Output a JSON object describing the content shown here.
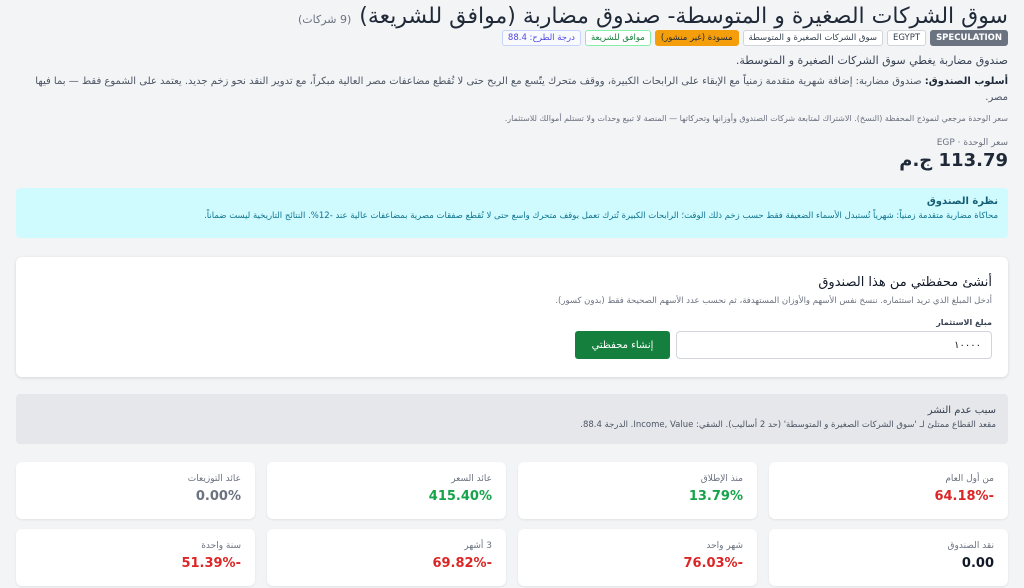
{
  "header": {
    "title": "سوق الشركات الصغيرة و المتوسطة- صندوق مضاربة (موافق للشريعة)",
    "count": "(9 شركات)"
  },
  "badges": [
    "SPECULATION",
    "EGYPT",
    "سوق الشركات الصغيرة و المتوسطة",
    "مسودة (غير منشور)",
    "موافق للشريعة",
    "درجة الطرح: 88.4"
  ],
  "subtitle": "صندوق مضاربة يغطي سوق الشركات الصغيرة و المتوسطة.",
  "style": {
    "label": "أسلوب الصندوق:",
    "text": " صندوق مضاربة: إضافة شهرية متقدمة زمنياً مع الإبقاء على الرابحات الكبيرة، ووقف متحرك يتّسع مع الربح حتى لا تُقطع مضاعفات مصر العالية مبكراً، مع تدوير النقد نحو زخم جديد. يعتمد على الشموع فقط — بما فيها مصر."
  },
  "disclaimer": "سعر الوحدة مرجعي لنموذج المحفظة (النسخ). الاشتراك لمتابعة شركات الصندوق وأوزانها وتحركاتها — المنصة لا تبيع وحدات ولا تستلم أموالك للاستثمار.",
  "unit_price": {
    "label": "سعر الوحدة · EGP",
    "value": "113.79 ج.م"
  },
  "view": {
    "title": "نظرة الصندوق",
    "text": "محاكاة مضاربة متقدمة زمنياً: شهرياً تُستبدل الأسماء الضعيفة فقط حسب زخم ذلك الوقت؛ الرابحات الكبيرة تُترك تعمل بوقف متحرك واسع حتى لا تُقطع صفقات مصرية بمضاعفات عالية عند -12%. النتائج التاريخية ليست ضماناً."
  },
  "create": {
    "title": "أنشئ محفظتي من هذا الصندوق",
    "hint": "أدخل المبلغ الذي تريد استثماره. ننسخ نفس الأسهم والأوزان المستهدفة، ثم نحسب عدد الأسهم الصحيحة فقط (بدون كسور).",
    "amount_label": "مبلغ الاستثمار",
    "amount_value": "١٠٠٠٠",
    "button_label": "إنشاء محفظتي"
  },
  "reason": {
    "title": "سبب عدم النشر",
    "text": "مقعد القطاع ممتلئ لـ 'سوق الشركات الصغيرة و المتوسطة' (حد 2 أساليب). الشقي: Income, Value. الدرجة 88.4."
  },
  "stats": [
    {
      "label": "من أول العام",
      "value": "-64.18%",
      "tone": "neg"
    },
    {
      "label": "منذ الإطلاق",
      "value": "13.79%",
      "tone": "pos"
    },
    {
      "label": "عائد السعر",
      "value": "415.40%",
      "tone": "pos"
    },
    {
      "label": "عائد التوزيعات",
      "value": "0.00%",
      "tone": "neutral"
    },
    {
      "label": "نقد الصندوق",
      "value": "0.00",
      "tone": "dark"
    },
    {
      "label": "شهر واحد",
      "value": "-76.03%",
      "tone": "neg"
    },
    {
      "label": "3 أشهر",
      "value": "-69.82%",
      "tone": "neg"
    },
    {
      "label": "سنة واحدة",
      "value": "-51.39%",
      "tone": "neg"
    }
  ],
  "colors": {
    "accent_green": "#15803d",
    "negative": "#dc2626",
    "positive": "#16a34a",
    "info_bg": "#cffafe"
  }
}
